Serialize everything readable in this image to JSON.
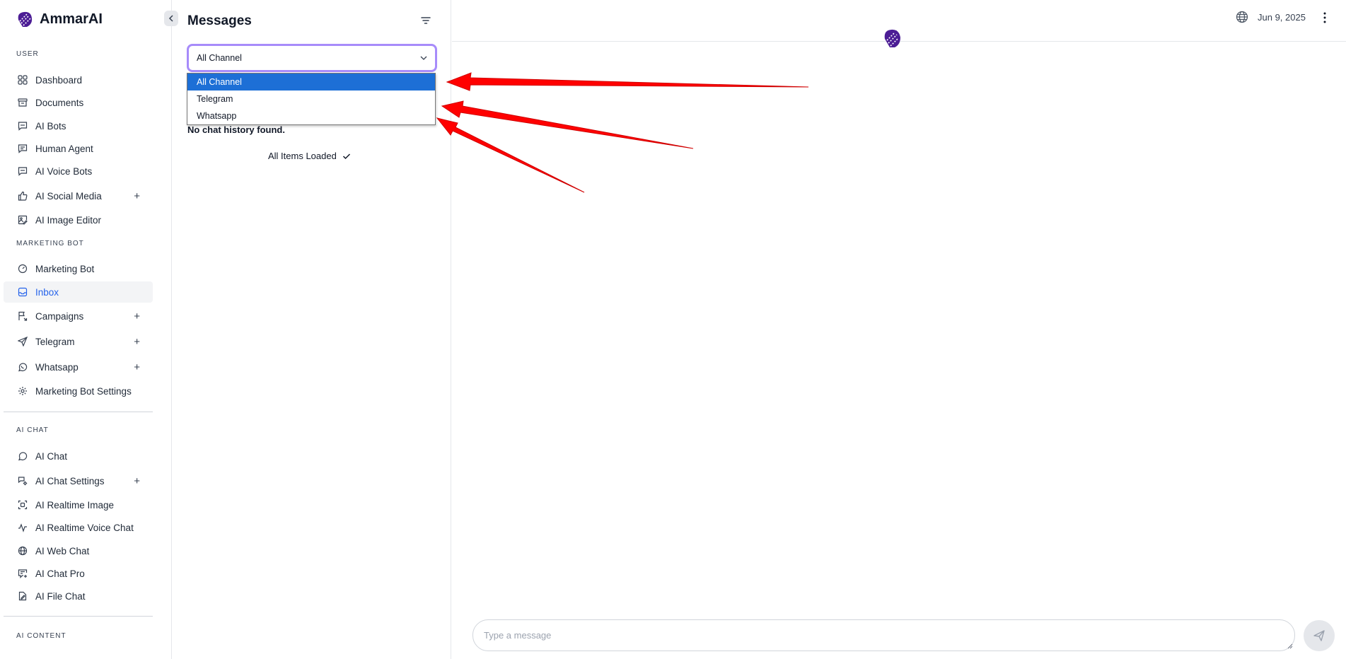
{
  "app": {
    "name": "AmmarAI"
  },
  "sidebar": {
    "sections": {
      "user": "USER",
      "marketing": "MARKETING BOT",
      "ai_chat": "AI CHAT",
      "ai_content": "AI CONTENT"
    },
    "items": [
      {
        "label": "Dashboard",
        "icon": "grid-icon"
      },
      {
        "label": "Documents",
        "icon": "archive-icon"
      },
      {
        "label": "AI Bots",
        "icon": "chat-square-icon"
      },
      {
        "label": "Human Agent",
        "icon": "chat-lines-icon"
      },
      {
        "label": "AI Voice Bots",
        "icon": "chat-square-icon"
      },
      {
        "label": "AI Social Media",
        "icon": "thumbs-up-icon",
        "expandable": "+"
      },
      {
        "label": "AI Image Editor",
        "icon": "image-edit-icon"
      },
      {
        "label": "Marketing Bot",
        "icon": "gauge-icon"
      },
      {
        "label": "Inbox",
        "icon": "inbox-icon",
        "active": true
      },
      {
        "label": "Campaigns",
        "icon": "flag-icon",
        "expandable": "+"
      },
      {
        "label": "Telegram",
        "icon": "send-icon",
        "expandable": "+"
      },
      {
        "label": "Whatsapp",
        "icon": "whatsapp-icon",
        "expandable": "+"
      },
      {
        "label": "Marketing Bot Settings",
        "icon": "settings-icon"
      },
      {
        "label": "AI Chat",
        "icon": "chat-bubble-icon"
      },
      {
        "label": "AI Chat Settings",
        "icon": "chat-settings-icon",
        "expandable": "+"
      },
      {
        "label": "AI Realtime Image",
        "icon": "image-scan-icon"
      },
      {
        "label": "AI Realtime Voice Chat",
        "icon": "wave-icon"
      },
      {
        "label": "AI Web Chat",
        "icon": "globe-icon"
      },
      {
        "label": "AI Chat Pro",
        "icon": "chat-plus-icon"
      },
      {
        "label": "AI File Chat",
        "icon": "file-edit-icon"
      }
    ]
  },
  "messages": {
    "title": "Messages",
    "channel_select": {
      "value": "All Channel",
      "options": [
        "All Channel",
        "Telegram",
        "Whatsapp"
      ],
      "selected_index": 0
    },
    "empty_text": "No chat history found.",
    "loaded_text": "All Items Loaded"
  },
  "header": {
    "date": "Jun 9, 2025"
  },
  "composer": {
    "placeholder": "Type a message"
  },
  "colors": {
    "accent": "#2563eb",
    "select_border": "#a78bfa",
    "option_selected": "#1d6fd6",
    "brand": "#4c1d95",
    "arrow": "#ff0000"
  }
}
